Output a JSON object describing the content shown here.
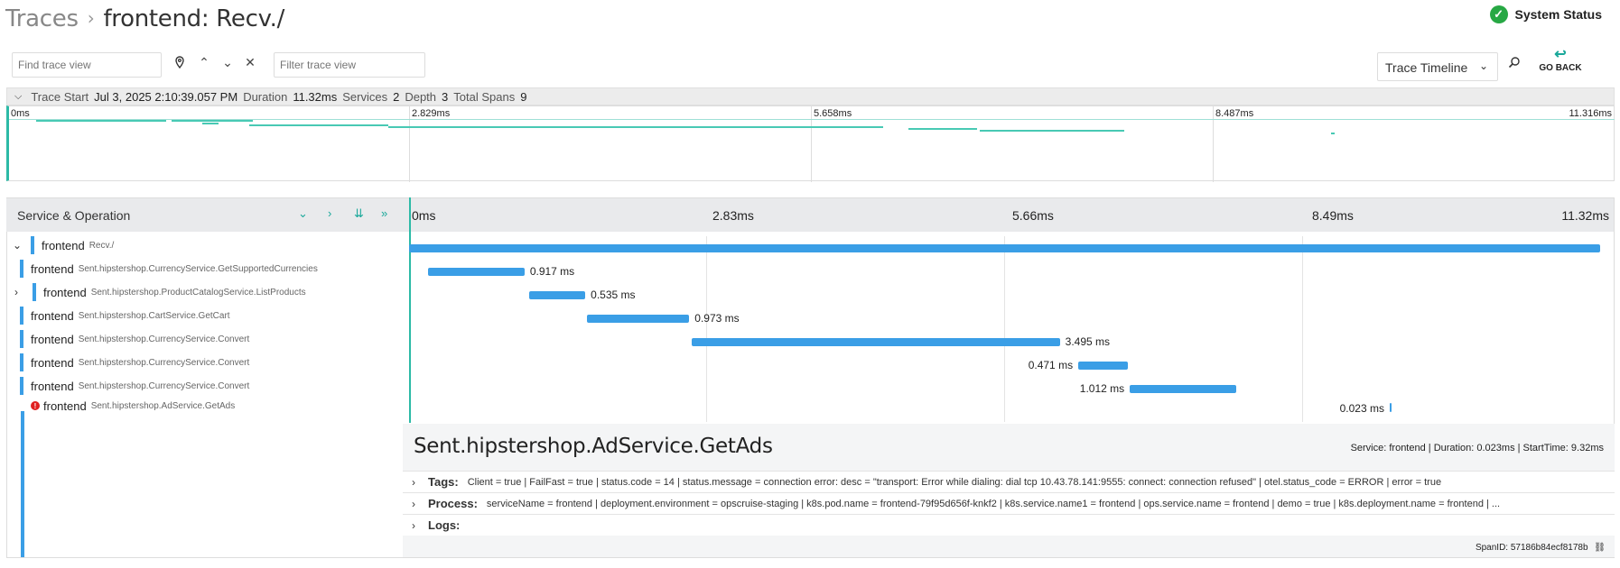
{
  "breadcrumb": {
    "root": "Traces",
    "separator": "›",
    "current": "frontend: Recv./"
  },
  "system_status": {
    "label": "System Status",
    "icon": "check-circle-icon",
    "color": "#27a844"
  },
  "toolbar": {
    "find_placeholder": "Find trace view",
    "filter_placeholder": "Filter trace view",
    "view_select": "Trace Timeline",
    "go_back": "GO BACK"
  },
  "trace_meta": {
    "start_label": "Trace Start",
    "start_value": "Jul 3, 2025 2:10:39.057 PM",
    "duration_label": "Duration",
    "duration_value": "11.32ms",
    "services_label": "Services",
    "services_value": "2",
    "depth_label": "Depth",
    "depth_value": "3",
    "spans_label": "Total Spans",
    "spans_value": "9"
  },
  "minimap_ticks": [
    "0ms",
    "2.829ms",
    "5.658ms",
    "8.487ms",
    "11.316ms"
  ],
  "main_header": {
    "service_operation": "Service & Operation"
  },
  "axis_ticks": [
    "0ms",
    "2.83ms",
    "5.66ms",
    "8.49ms",
    "11.32ms"
  ],
  "spans": [
    {
      "service": "frontend",
      "operation": "Recv./",
      "toggle": "expanded",
      "start_ms": 0,
      "duration_ms": 11.32,
      "label": ""
    },
    {
      "service": "frontend",
      "operation": "Sent.hipstershop.CurrencyService.GetSupportedCurrencies",
      "start_ms": 0.18,
      "duration_ms": 0.917,
      "label": "0.917 ms"
    },
    {
      "service": "frontend",
      "operation": "Sent.hipstershop.ProductCatalogService.ListProducts",
      "toggle": "collapsed",
      "start_ms": 1.14,
      "duration_ms": 0.535,
      "label": "0.535 ms"
    },
    {
      "service": "frontend",
      "operation": "Sent.hipstershop.CartService.GetCart",
      "start_ms": 1.69,
      "duration_ms": 0.973,
      "label": "0.973 ms"
    },
    {
      "service": "frontend",
      "operation": "Sent.hipstershop.CurrencyService.Convert",
      "start_ms": 2.69,
      "duration_ms": 3.495,
      "label": "3.495 ms"
    },
    {
      "service": "frontend",
      "operation": "Sent.hipstershop.CurrencyService.Convert",
      "start_ms": 6.36,
      "duration_ms": 0.471,
      "label": "0.471 ms"
    },
    {
      "service": "frontend",
      "operation": "Sent.hipstershop.CurrencyService.Convert",
      "start_ms": 6.85,
      "duration_ms": 1.012,
      "label": "1.012 ms"
    },
    {
      "service": "frontend",
      "operation": "Sent.hipstershop.AdService.GetAds",
      "error": true,
      "start_ms": 9.32,
      "duration_ms": 0.023,
      "label": "0.023 ms"
    }
  ],
  "detail": {
    "title": "Sent.hipstershop.AdService.GetAds",
    "meta": "Service: frontend | Duration: 0.023ms | StartTime: 9.32ms",
    "tags_label": "Tags:",
    "tags_value": "Client = true | FailFast = true | status.code = 14 | status.message = connection error: desc = \"transport: Error while dialing: dial tcp 10.43.78.141:9555: connect: connection refused\" | otel.status_code = ERROR | error = true",
    "process_label": "Process:",
    "process_value": "serviceName = frontend | deployment.environment = opscruise-staging | k8s.pod.name = frontend-79f95d656f-knkf2 | k8s.service.name1 = frontend | ops.service.name = frontend | demo = true | k8s.deployment.name = frontend | ...",
    "logs_label": "Logs:",
    "span_id_label": "SpanID:",
    "span_id_value": "57186b84ecf8178b"
  },
  "colors": {
    "accent": "#2cbaa6",
    "span_bar": "#3a9ee6",
    "error": "#e02020"
  }
}
